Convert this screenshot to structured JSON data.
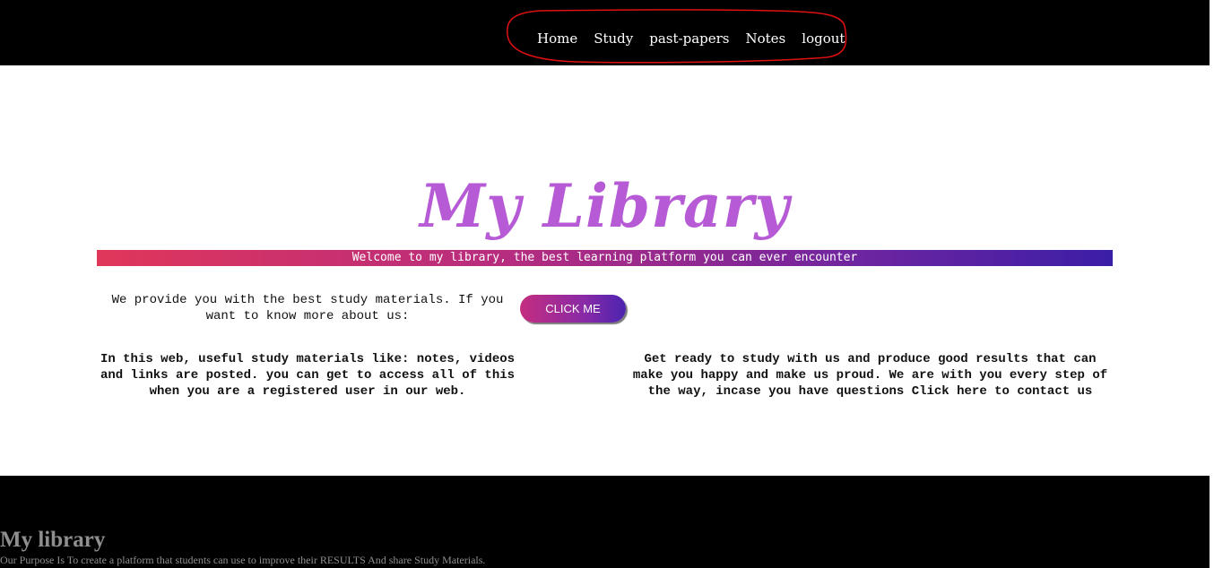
{
  "nav": {
    "items": [
      {
        "label": "Home"
      },
      {
        "label": "Study"
      },
      {
        "label": "past-papers"
      },
      {
        "label": "Notes"
      },
      {
        "label": "logout"
      }
    ]
  },
  "hero": {
    "title": "My Library",
    "welcome": "Welcome to my library, the best learning platform you can ever encounter"
  },
  "intro": {
    "text": "We provide you with the best study materials. If you want to know more about us:",
    "button_label": "CLICK ME"
  },
  "columns": {
    "left": "In this web, useful study materials like: notes, videos and links are posted. you can get to access all of this when you are a registered user in our web.",
    "right": "Get ready to study with us and produce good results that can make you happy and make us proud. We are with you every step of the way, incase you have questions Click here to contact us"
  },
  "footer": {
    "title": "My library",
    "text": "Our Purpose Is To create a platform that students can use to improve their RESULTS And share Study Materials."
  },
  "colors": {
    "title": "#b65ad6",
    "annotation_ring": "#e01010"
  }
}
